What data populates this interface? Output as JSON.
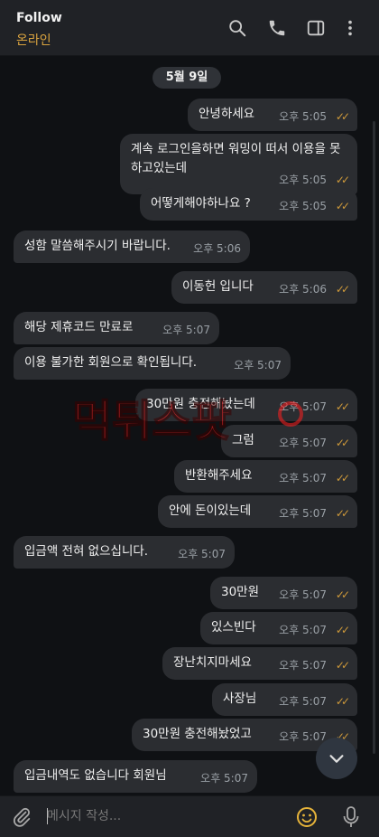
{
  "header": {
    "title": "Follow",
    "status": "온라인"
  },
  "date_label": "5월 9일",
  "messages": [
    {
      "dir": "out",
      "text": "안녕하세요",
      "time": "오후 5:05",
      "ticks": "✓✓"
    },
    {
      "dir": "out",
      "text": "계속 로그인을하면 워밍이 떠서 이용을 못하고있는데",
      "time": "오후 5:05",
      "ticks": "✓✓"
    },
    {
      "dir": "out",
      "text": "어떻게해야하나요 ?",
      "time": "오후 5:05",
      "ticks": "✓✓"
    },
    {
      "dir": "in",
      "text": "성함 말씀해주시기 바랍니다.",
      "time": "오후 5:06"
    },
    {
      "dir": "out",
      "text": "이동헌 입니다",
      "time": "오후 5:06",
      "ticks": "✓✓"
    },
    {
      "dir": "in",
      "text": "해당 제휴코드 만료로",
      "time": "오후 5:07"
    },
    {
      "dir": "in",
      "text": "이용 불가한 회원으로 확인됩니다.",
      "time": "오후 5:07"
    },
    {
      "dir": "out",
      "text": "30만원 충전해놨는데",
      "time": "오후 5:07",
      "ticks": "✓✓"
    },
    {
      "dir": "out",
      "text": "그럼",
      "time": "오후 5:07",
      "ticks": "✓✓"
    },
    {
      "dir": "out",
      "text": "반환해주세요",
      "time": "오후 5:07",
      "ticks": "✓✓"
    },
    {
      "dir": "out",
      "text": "안에 돈이있는데",
      "time": "오후 5:07",
      "ticks": "✓✓"
    },
    {
      "dir": "in",
      "text": "입금액 전혀 없으십니다.",
      "time": "오후 5:07"
    },
    {
      "dir": "out",
      "text": "30만원",
      "time": "오후 5:07",
      "ticks": "✓✓"
    },
    {
      "dir": "out",
      "text": "있스빈다",
      "time": "오후 5:07",
      "ticks": "✓✓"
    },
    {
      "dir": "out",
      "text": "장난치지마세요",
      "time": "오후 5:07",
      "ticks": "✓✓"
    },
    {
      "dir": "out",
      "text": "사장님",
      "time": "오후 5:07",
      "ticks": "✓✓"
    },
    {
      "dir": "out",
      "text": "30만원 충전해놨었고",
      "time": "오후 5:07",
      "ticks": "✓✓"
    },
    {
      "dir": "in",
      "text": "입금내역도 없습니다 회원님",
      "time": "오후 5:07"
    }
  ],
  "composer": {
    "placeholder": "메시지 작성..."
  },
  "watermark_text": "먹튀스팟",
  "colors": {
    "accent": "#d9a33f",
    "bubble": "#2b2d31",
    "background": "#0f1114"
  }
}
